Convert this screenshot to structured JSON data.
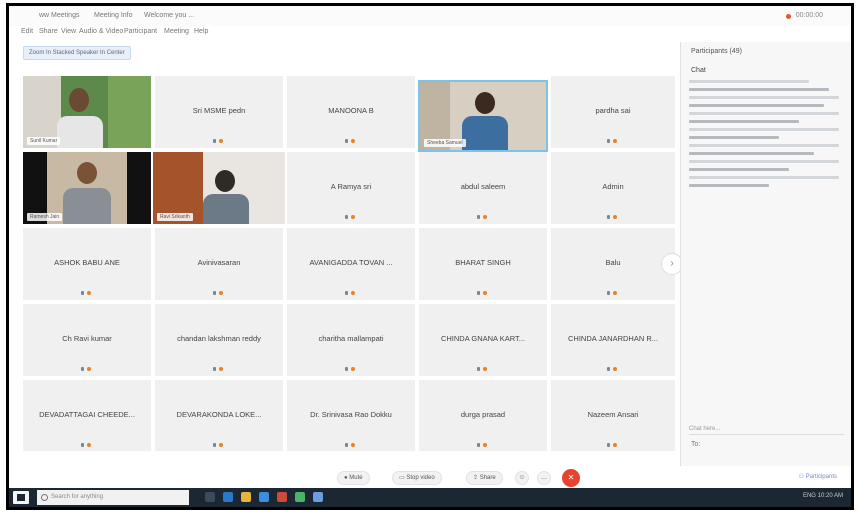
{
  "window": {
    "title_segments": [
      "ww Meetings",
      "Meeting Info",
      "Welcome you ..."
    ],
    "recording": "00:00:00"
  },
  "menu": [
    "Edit",
    "Share",
    "View",
    "Audio & Video",
    "Participant",
    "Meeting",
    "Help"
  ],
  "focus_button": "Zoom In  Stacked Speaker In Center",
  "participants": [
    {
      "name": "Sunil Kumar",
      "video": true
    },
    {
      "name": "Sri MSME pedn",
      "video": false
    },
    {
      "name": "MANOONA B",
      "video": false
    },
    {
      "name": "Sheeba Samuel",
      "video": true
    },
    {
      "name": "pardha sai",
      "video": false
    },
    {
      "name": "Ramesh Jain",
      "video": true
    },
    {
      "name": "Ravi Srikanth",
      "video": true
    },
    {
      "name": "A Ramya sri",
      "video": false
    },
    {
      "name": "abdul saleem",
      "video": false
    },
    {
      "name": "Admin",
      "video": false
    },
    {
      "name": "ASHOK BABU ANE",
      "video": false
    },
    {
      "name": "Avinivasaran",
      "video": false
    },
    {
      "name": "AVANIGADDA TOVAN ...",
      "video": false
    },
    {
      "name": "BHARAT SINGH",
      "video": false
    },
    {
      "name": "Balu",
      "video": false
    },
    {
      "name": "Ch Ravi kumar",
      "video": false
    },
    {
      "name": "chandan lakshman reddy",
      "video": false
    },
    {
      "name": "charitha mallampati",
      "video": false
    },
    {
      "name": "CHINDA GNANA KART...",
      "video": false
    },
    {
      "name": "CHINDA JANARDHAN R...",
      "video": false
    },
    {
      "name": "DEVADATTAGAI CHEEDE...",
      "video": false
    },
    {
      "name": "DEVARAKONDA LOKE...",
      "video": false
    },
    {
      "name": "Dr. Srinivasa Rao Dokku",
      "video": false
    },
    {
      "name": "durga prasad",
      "video": false
    },
    {
      "name": "Nazeem Ansari",
      "video": false
    }
  ],
  "side_panel": {
    "participants_label": "Participants (49)",
    "chat_label": "Chat",
    "chat_placeholder": "Chat here...",
    "send_label": "To:"
  },
  "toolbar": {
    "mute": "Mute",
    "stop_video": "Stop video",
    "share": "Share",
    "more": "...",
    "participants": "Participants"
  },
  "taskbar": {
    "search_placeholder": "Search for anything",
    "tray": "ENG  10:20 AM"
  },
  "colors": {
    "end_button": "#e8432f",
    "mic_on": "#7a8896",
    "mic_indicator": "#e8822a",
    "taskbar": "#1b2733"
  }
}
